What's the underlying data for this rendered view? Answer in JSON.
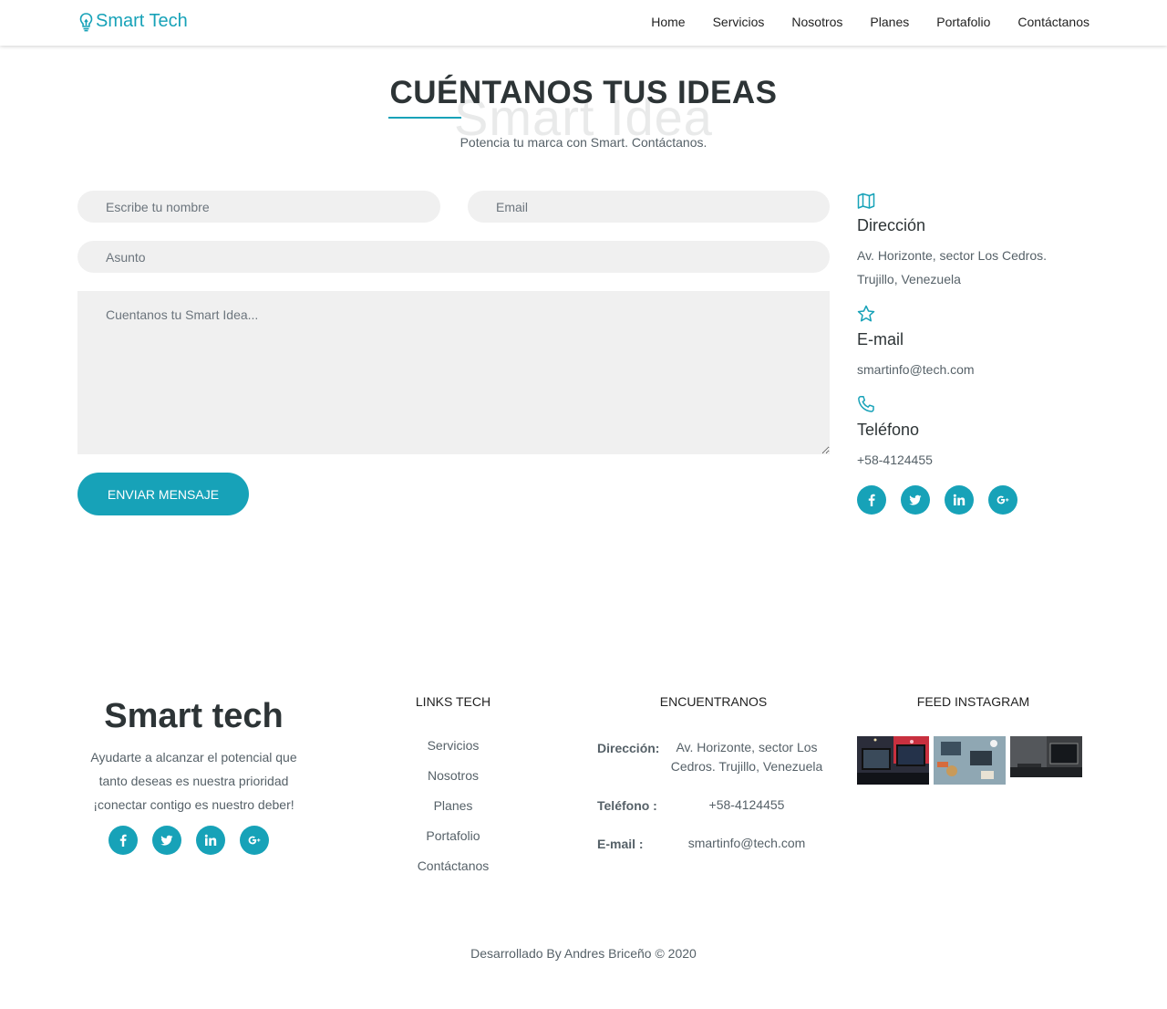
{
  "nav": {
    "brand": "Smart Tech",
    "items": [
      "Home",
      "Servicios",
      "Nosotros",
      "Planes",
      "Portafolio",
      "Contáctanos"
    ]
  },
  "section": {
    "title": "CUÉNTANOS TUS IDEAS",
    "background_word": "Smart Idea",
    "subtitle": "Potencia tu marca con Smart. Contáctanos."
  },
  "form": {
    "name_placeholder": "Escribe tu nombre",
    "email_placeholder": "Email",
    "subject_placeholder": "Asunto",
    "message_placeholder": "Cuentanos tu Smart Idea...",
    "submit_label": "ENVIAR MENSAJE"
  },
  "contact": {
    "address_title": "Dirección",
    "address_line1": "Av. Horizonte, sector Los Cedros.",
    "address_line2": "Trujillo, Venezuela",
    "email_title": "E-mail",
    "email_value": "smartinfo@tech.com",
    "phone_title": "Teléfono",
    "phone_value": "+58-4124455",
    "social_icons": [
      "facebook-icon",
      "twitter-icon",
      "linkedin-icon",
      "google-plus-icon"
    ]
  },
  "footer": {
    "brand": "Smart tech",
    "description_line1": "Ayudarte a alcanzar el potencial que",
    "description_line2": "tanto deseas es nuestra prioridad",
    "description_line3": "¡conectar contigo es nuestro deber!",
    "links_title": "LINKS TECH",
    "links": [
      "Servicios",
      "Nosotros",
      "Planes",
      "Portafolio",
      "Contáctanos"
    ],
    "find_title": "ENCUENTRANOS",
    "address_label": "Dirección:",
    "address_value_line1": "Av. Horizonte, sector Los",
    "address_value_line2": "Cedros. Trujillo, Venezuela",
    "phone_label": "Teléfono :",
    "phone_value": "+58-4124455",
    "email_label": "E-mail :",
    "email_value": "smartinfo@tech.com",
    "instagram_title": "FEED INSTAGRAM",
    "credit": "Desarrollado By Andres Briceño © 2020"
  },
  "colors": {
    "accent": "#17a2b8",
    "text_dark": "#2d3436",
    "text_muted": "#566168",
    "field_bg": "#f0f0f0"
  }
}
